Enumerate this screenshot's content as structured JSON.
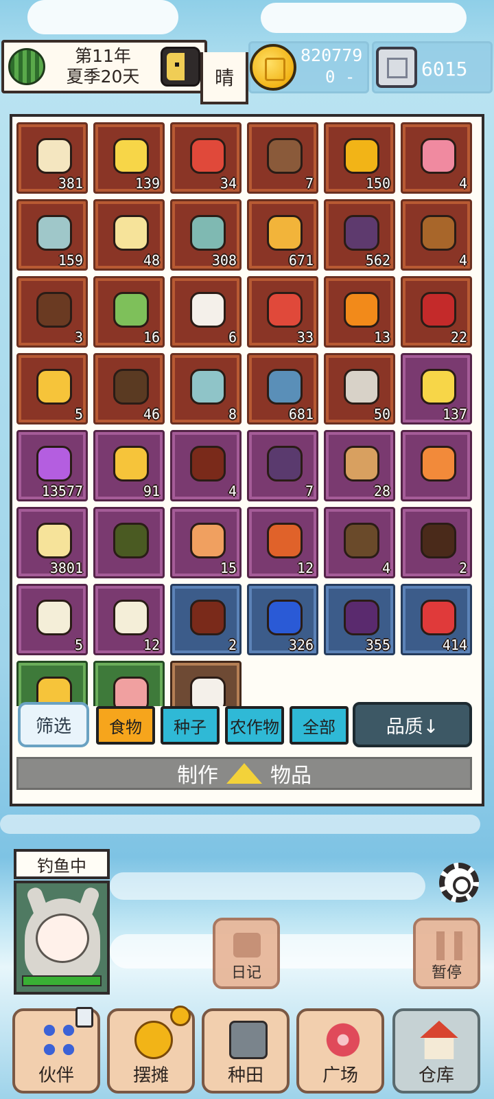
{
  "hud": {
    "year": "第11年",
    "season_day": "夏季20天",
    "weather": "晴",
    "gold": "820779",
    "gold_delta": "0 -",
    "gems": "6015"
  },
  "inventory": {
    "items": [
      {
        "count": "381",
        "bg": "red",
        "color": "#f4e6c0"
      },
      {
        "count": "139",
        "bg": "red",
        "color": "#f7d648"
      },
      {
        "count": "34",
        "bg": "red",
        "color": "#e0493a"
      },
      {
        "count": "7",
        "bg": "red",
        "color": "#8a5a3a"
      },
      {
        "count": "150",
        "bg": "red",
        "color": "#f2b417"
      },
      {
        "count": "4",
        "bg": "red",
        "color": "#f08aa0"
      },
      {
        "count": "159",
        "bg": "red",
        "color": "#9fc7c9"
      },
      {
        "count": "48",
        "bg": "red",
        "color": "#f6e39a"
      },
      {
        "count": "308",
        "bg": "red",
        "color": "#7fb9b2"
      },
      {
        "count": "671",
        "bg": "red",
        "color": "#f2b43a"
      },
      {
        "count": "562",
        "bg": "red",
        "color": "#5e3a6e"
      },
      {
        "count": "4",
        "bg": "red",
        "color": "#a8662a"
      },
      {
        "count": "3",
        "bg": "red",
        "color": "#6a3a22"
      },
      {
        "count": "16",
        "bg": "red",
        "color": "#7ec05a"
      },
      {
        "count": "6",
        "bg": "red",
        "color": "#f4f0ea"
      },
      {
        "count": "33",
        "bg": "red",
        "color": "#e0493a"
      },
      {
        "count": "13",
        "bg": "red",
        "color": "#f28a1a"
      },
      {
        "count": "22",
        "bg": "red",
        "color": "#c42a2a"
      },
      {
        "count": "5",
        "bg": "red",
        "color": "#f6c43a"
      },
      {
        "count": "46",
        "bg": "red",
        "color": "#5a3a22"
      },
      {
        "count": "8",
        "bg": "red",
        "color": "#8fc4c8"
      },
      {
        "count": "681",
        "bg": "red",
        "color": "#5a8fb8"
      },
      {
        "count": "50",
        "bg": "red",
        "color": "#d8d2c8"
      },
      {
        "count": "137",
        "bg": "purple",
        "color": "#f7d648"
      },
      {
        "count": "13577",
        "bg": "purple",
        "color": "#b45ee0"
      },
      {
        "count": "91",
        "bg": "purple",
        "color": "#f6c43a"
      },
      {
        "count": "4",
        "bg": "purple",
        "color": "#7a2a1a"
      },
      {
        "count": "7",
        "bg": "purple",
        "color": "#5a3a6e"
      },
      {
        "count": "28",
        "bg": "purple",
        "color": "#d8a060"
      },
      {
        "count": "",
        "bg": "purple",
        "color": "#f28a3a"
      },
      {
        "count": "3801",
        "bg": "purple",
        "color": "#f6e39a"
      },
      {
        "count": "",
        "bg": "purple",
        "color": "#4a5a22"
      },
      {
        "count": "15",
        "bg": "purple",
        "color": "#f0a060"
      },
      {
        "count": "12",
        "bg": "purple",
        "color": "#e0622a"
      },
      {
        "count": "4",
        "bg": "purple",
        "color": "#6a4a2a"
      },
      {
        "count": "2",
        "bg": "purple",
        "color": "#4a2a1a"
      },
      {
        "count": "5",
        "bg": "purple",
        "color": "#f4eed8"
      },
      {
        "count": "12",
        "bg": "purple",
        "color": "#f4eed8"
      },
      {
        "count": "2",
        "bg": "blue",
        "color": "#7a2a1a"
      },
      {
        "count": "326",
        "bg": "blue",
        "color": "#2a5ad6"
      },
      {
        "count": "355",
        "bg": "blue",
        "color": "#5a2a6e"
      },
      {
        "count": "414",
        "bg": "blue",
        "color": "#e03a3a"
      },
      {
        "count": "",
        "bg": "green",
        "color": "#f6c43a"
      },
      {
        "count": "",
        "bg": "green",
        "color": "#f0a0a0"
      },
      {
        "count": "",
        "bg": "tan",
        "color": "#f4f0ea"
      }
    ]
  },
  "filters": {
    "filter_label": "筛选",
    "tabs": [
      "食物",
      "种子",
      "农作物",
      "全部"
    ],
    "sort_label": "品质↓"
  },
  "craft": {
    "left": "制作",
    "right": "物品"
  },
  "companion": {
    "status": "钓鱼中",
    "hp_fraction": 1.0
  },
  "side_buttons": {
    "diary": "日记",
    "pause": "暂停"
  },
  "nav": {
    "companions": "伙伴",
    "stall": "摆摊",
    "farm": "种田",
    "plaza": "广场",
    "warehouse": "仓库"
  },
  "colors": {
    "active_tab": "#f6a51c",
    "idle_tab": "#2fb9d6",
    "hp": "#39b034"
  }
}
